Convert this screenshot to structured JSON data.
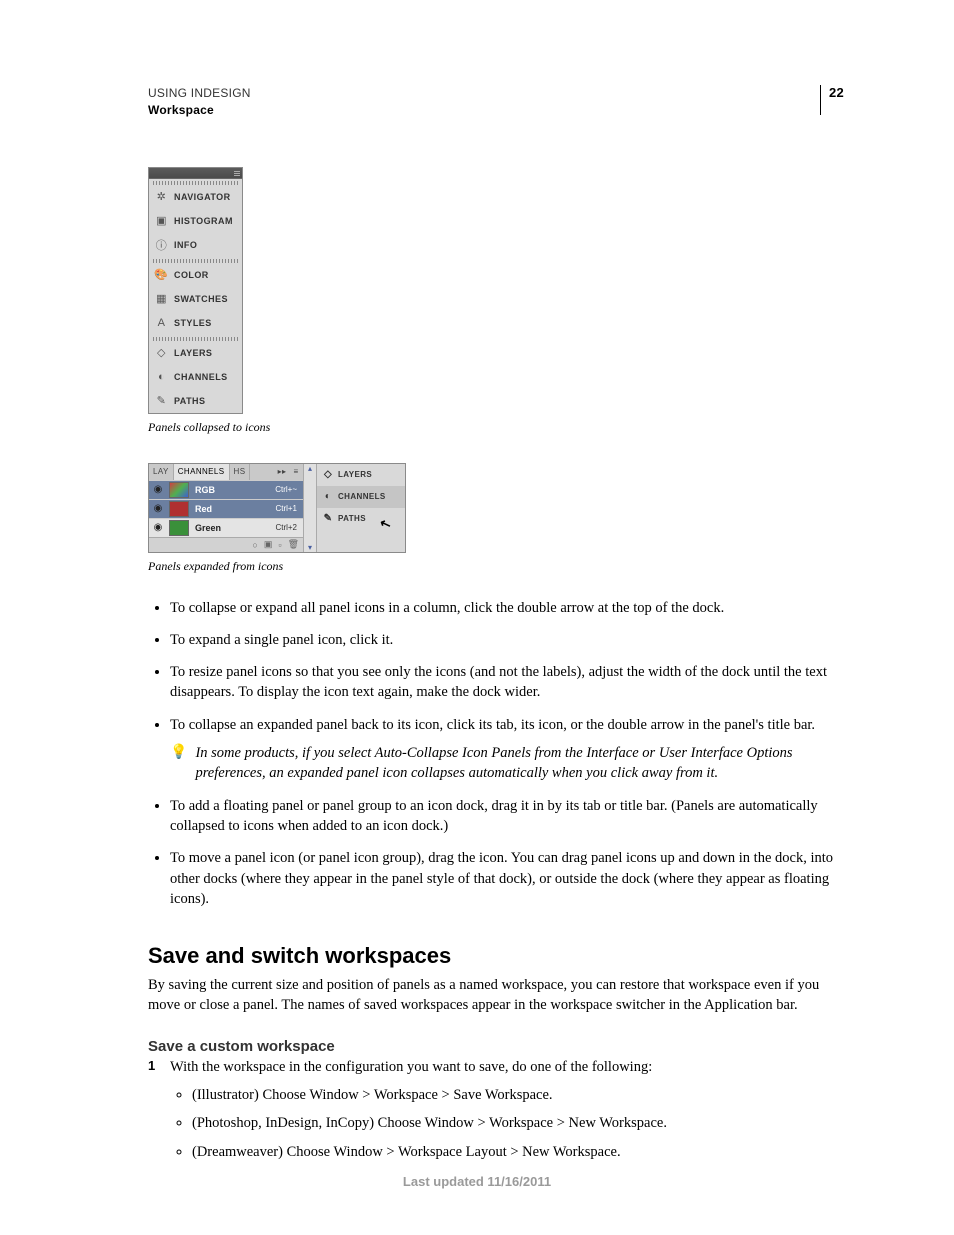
{
  "header": {
    "chapter": "USING INDESIGN",
    "section": "Workspace",
    "page_number": "22"
  },
  "figure1": {
    "items": [
      {
        "icon": "✲",
        "label": "NAVIGATOR"
      },
      {
        "icon": "▣",
        "label": "HISTOGRAM"
      },
      {
        "icon": "ⓘ",
        "label": "INFO"
      }
    ],
    "items2": [
      {
        "icon": "🎨",
        "label": "COLOR"
      },
      {
        "icon": "▦",
        "label": "SWATCHES"
      },
      {
        "icon": "A",
        "label": "STYLES"
      }
    ],
    "items3": [
      {
        "icon": "◇",
        "label": "LAYERS"
      },
      {
        "icon": "◐",
        "label": "CHANNELS"
      },
      {
        "icon": "✎",
        "label": "PATHS"
      }
    ],
    "caption": "Panels collapsed to icons"
  },
  "figure2": {
    "tabs": {
      "a": "LAY",
      "b": "CHANNELS",
      "c": "HS"
    },
    "rows": [
      {
        "swatch": "linear-gradient(135deg,#f00,#0f0 50%,#00f)",
        "label": "RGB",
        "shortcut": "Ctrl+~",
        "sel": true
      },
      {
        "swatch": "#c02020",
        "label": "Red",
        "shortcut": "Ctrl+1",
        "sel": true
      },
      {
        "swatch": "#20a020",
        "label": "Green",
        "shortcut": "Ctrl+2",
        "sel": false
      }
    ],
    "mini": [
      {
        "icon": "◇",
        "label": "LAYERS",
        "active": false
      },
      {
        "icon": "◐",
        "label": "CHANNELS",
        "active": true
      },
      {
        "icon": "✎",
        "label": "PATHS",
        "active": false
      }
    ],
    "caption": "Panels expanded from icons"
  },
  "bullets": [
    "To collapse or expand all panel icons in a column, click the double arrow at the top of the dock.",
    "To expand a single panel icon, click it.",
    "To resize panel icons so that you see only the icons (and not the labels), adjust the width of the dock until the text disappears. To display the icon text again, make the dock wider.",
    "To collapse an expanded panel back to its icon, click its tab, its icon, or the double arrow in the panel's title bar."
  ],
  "tip": "In some products, if you select Auto-Collapse Icon Panels from the Interface or User Interface Options preferences, an expanded panel icon collapses automatically when you click away from it.",
  "bullets2": [
    "To add a floating panel or panel group to an icon dock, drag it in by its tab or title bar. (Panels are automatically collapsed to icons when added to an icon dock.)",
    "To move a panel icon (or panel icon group), drag the icon. You can drag panel icons up and down in the dock, into other docks (where they appear in the panel style of that dock), or outside the dock (where they appear as floating icons)."
  ],
  "section2": {
    "heading": "Save and switch workspaces",
    "paragraph": "By saving the current size and position of panels as a named workspace, you can restore that workspace even if you move or close a panel. The names of saved workspaces appear in the workspace switcher in the Application bar."
  },
  "subsection": {
    "heading": "Save a custom workspace",
    "step1": "With the workspace in the configuration you want to save, do one of the following:",
    "options": [
      "(Illustrator) Choose Window > Workspace > Save Workspace.",
      "(Photoshop, InDesign, InCopy) Choose Window > Workspace > New Workspace.",
      "(Dreamweaver) Choose Window > Workspace Layout > New Workspace."
    ]
  },
  "footer": "Last updated 11/16/2011"
}
